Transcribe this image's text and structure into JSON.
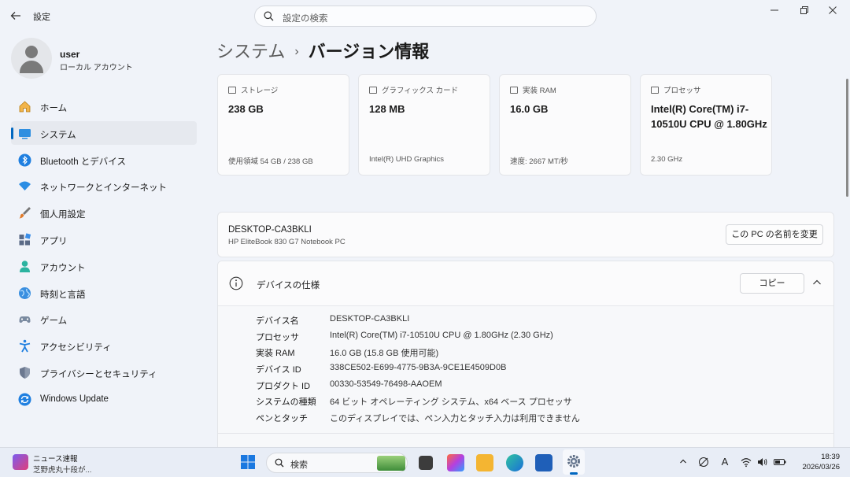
{
  "window": {
    "app_title": "設定",
    "search_placeholder": "設定の検索"
  },
  "user": {
    "name": "user",
    "account_type": "ローカル アカウント"
  },
  "sidebar": {
    "items": [
      {
        "label": "ホーム",
        "icon": "home-icon"
      },
      {
        "label": "システム",
        "icon": "system-icon",
        "active": true
      },
      {
        "label": "Bluetooth とデバイス",
        "icon": "bluetooth-icon"
      },
      {
        "label": "ネットワークとインターネット",
        "icon": "wifi-icon"
      },
      {
        "label": "個人用設定",
        "icon": "brush-icon"
      },
      {
        "label": "アプリ",
        "icon": "apps-icon"
      },
      {
        "label": "アカウント",
        "icon": "account-icon"
      },
      {
        "label": "時刻と言語",
        "icon": "globe-icon"
      },
      {
        "label": "ゲーム",
        "icon": "gamepad-icon"
      },
      {
        "label": "アクセシビリティ",
        "icon": "accessibility-icon"
      },
      {
        "label": "プライバシーとセキュリティ",
        "icon": "shield-icon"
      },
      {
        "label": "Windows Update",
        "icon": "update-icon"
      }
    ]
  },
  "breadcrumb": {
    "parent": "システム",
    "separator": "›",
    "current": "バージョン情報"
  },
  "cards": [
    {
      "title": "ストレージ",
      "value": "238 GB",
      "footer": "使用領域 54 GB / 238 GB",
      "icon": "storage-icon"
    },
    {
      "title": "グラフィックス カード",
      "value": "128 MB",
      "footer": "Intel(R) UHD Graphics",
      "icon": "gpu-icon"
    },
    {
      "title": "実装 RAM",
      "value": "16.0 GB",
      "footer": "速度: 2667 MT/秒",
      "icon": "ram-icon"
    },
    {
      "title": "プロセッサ",
      "value": "Intel(R) Core(TM) i7-10510U CPU @ 1.80GHz",
      "footer": "2.30 GHz",
      "icon": "cpu-icon"
    }
  ],
  "pc": {
    "name": "DESKTOP-CA3BKLI",
    "model": "HP EliteBook 830 G7 Notebook PC",
    "rename_label": "この PC の名前を変更"
  },
  "device_spec": {
    "title": "デバイスの仕様",
    "copy_label": "コピー",
    "rows": [
      {
        "key": "デバイス名",
        "value": "DESKTOP-CA3BKLI"
      },
      {
        "key": "プロセッサ",
        "value": "Intel(R) Core(TM) i7-10510U CPU @ 1.80GHz (2.30 GHz)"
      },
      {
        "key": "実装 RAM",
        "value": "16.0 GB (15.8 GB 使用可能)"
      },
      {
        "key": "デバイス ID",
        "value": "338CE502-E699-4775-9B3A-9CE1E4509D0B"
      },
      {
        "key": "プロダクト ID",
        "value": "00330-53549-76498-AAOEM"
      },
      {
        "key": "システムの種類",
        "value": "64 ビット オペレーティング システム、x64 ベース プロセッサ"
      },
      {
        "key": "ペンとタッチ",
        "value": "このディスプレイでは、ペン入力とタッチ入力は利用できません"
      }
    ]
  },
  "taskbar": {
    "news_title": "ニュース速報",
    "news_sub": "芝野虎丸十段が...",
    "search_label": "検索",
    "time": "18:39",
    "date": "2026/03/26"
  },
  "colors": {
    "accent": "#0067c0",
    "background": "#f0f3f9",
    "card": "#fbfbfc"
  }
}
